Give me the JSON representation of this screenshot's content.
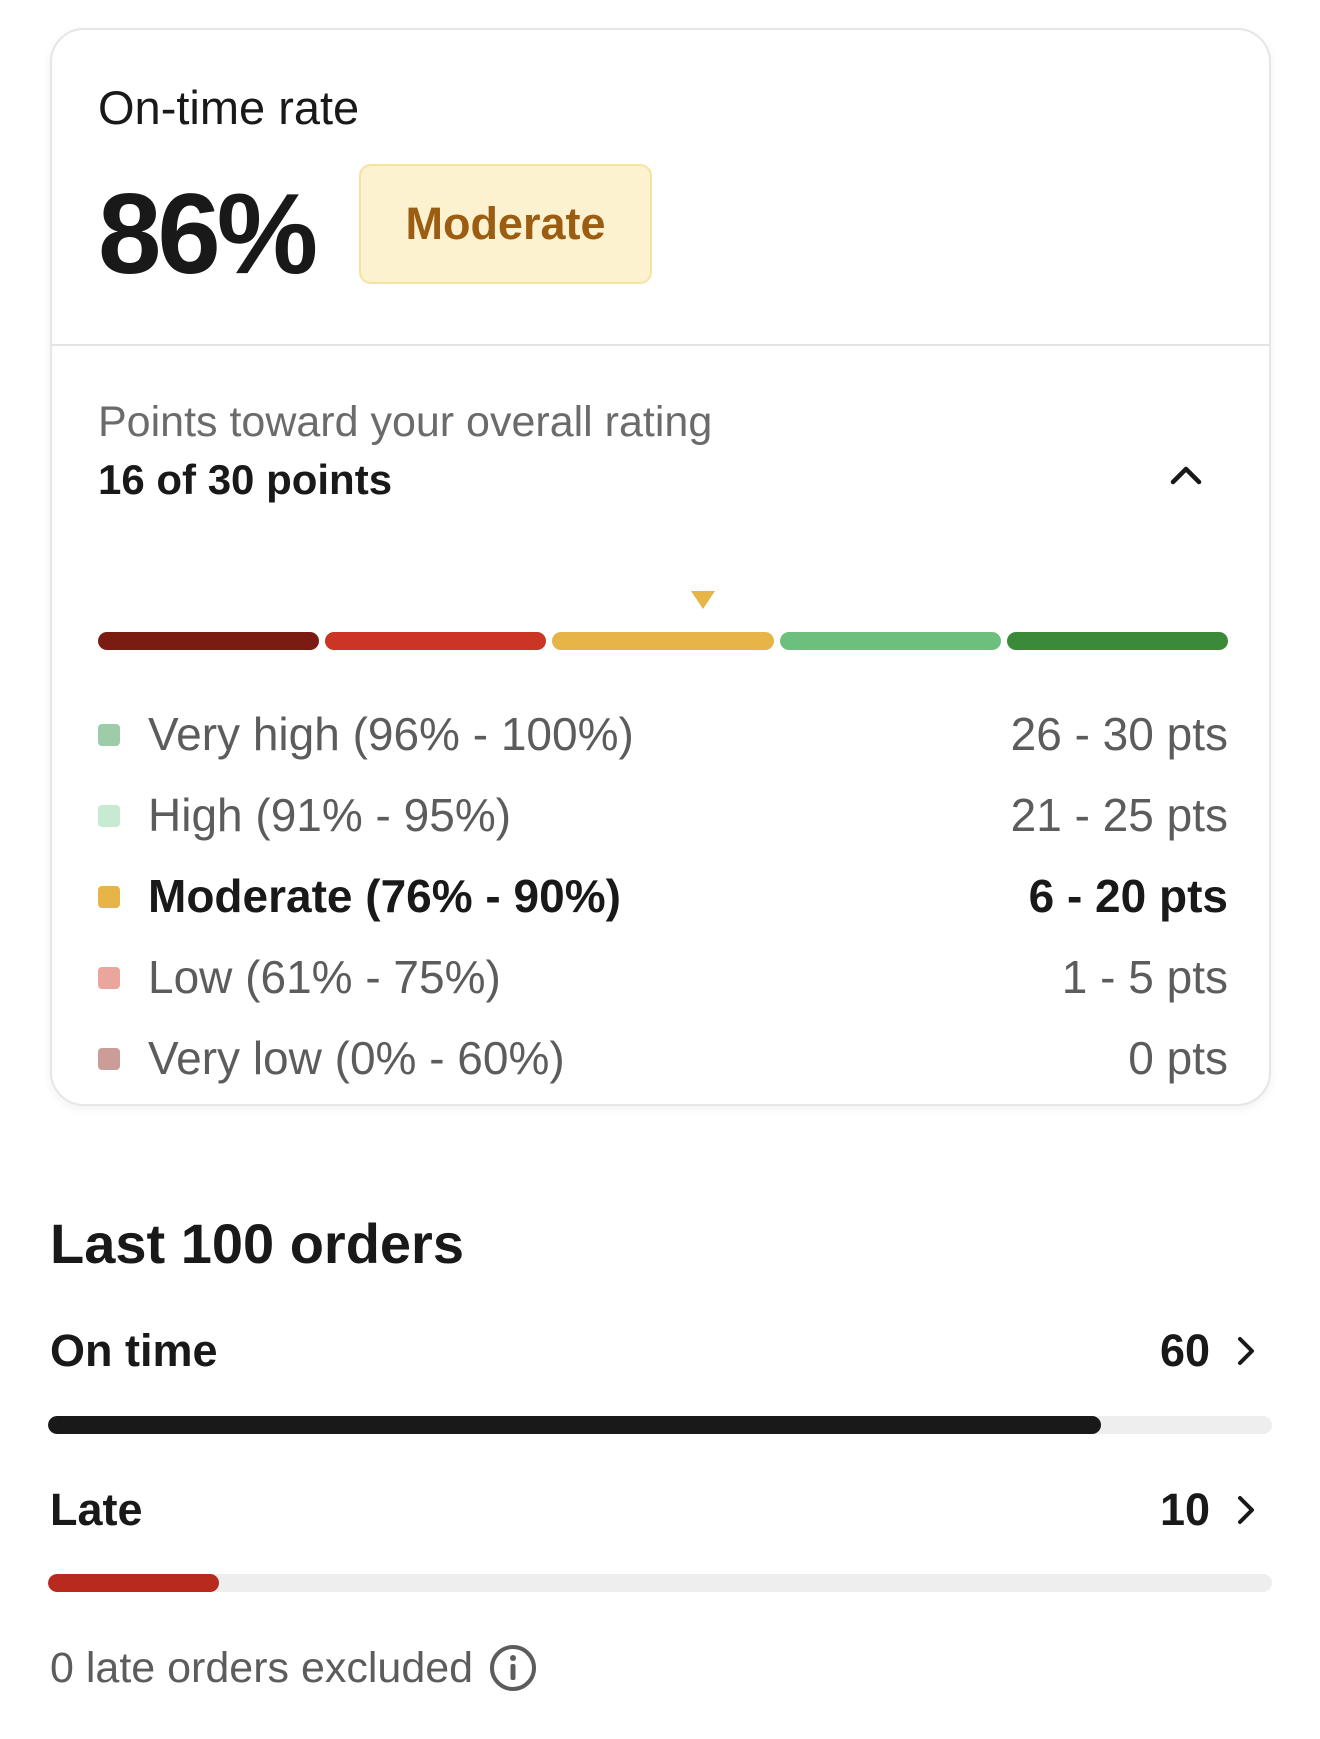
{
  "rate_card": {
    "title": "On-time rate",
    "value": "86%",
    "badge": "Moderate",
    "badge_colors": {
      "bg": "#fdf2cf",
      "text": "#9a5d12"
    }
  },
  "points": {
    "label": "Points toward your overall rating",
    "value": "16 of 30 points",
    "current_segment": 2,
    "segments": [
      {
        "color": "#7b1c12"
      },
      {
        "color": "#cb3526"
      },
      {
        "color": "#e6b447"
      },
      {
        "color": "#6dbf7d"
      },
      {
        "color": "#3b8a3a"
      }
    ],
    "collapse_icon": "chevron-up-icon"
  },
  "legend": [
    {
      "label": "Very high (96% - 100%)",
      "pts": "26 - 30 pts",
      "color": "#9dcca9",
      "active": false
    },
    {
      "label": "High (91% - 95%)",
      "pts": "21 - 25 pts",
      "color": "#c8ead2",
      "active": false
    },
    {
      "label": "Moderate (76% - 90%)",
      "pts": "6 - 20 pts",
      "color": "#e6b447",
      "active": true
    },
    {
      "label": "Low (61% - 75%)",
      "pts": "1 - 5 pts",
      "color": "#eaa59f",
      "active": false
    },
    {
      "label": "Very low (0% - 60%)",
      "pts": "0 pts",
      "color": "#cc9c98",
      "active": false
    }
  ],
  "orders": {
    "title": "Last 100 orders",
    "rows": [
      {
        "label": "On time",
        "count": "60",
        "fill": 0.86,
        "color": "#191919"
      },
      {
        "label": "Late",
        "count": "10",
        "fill": 0.14,
        "color": "#b82a1d"
      }
    ],
    "excluded_text": "0 late orders excluded",
    "info_icon": "info-icon"
  }
}
